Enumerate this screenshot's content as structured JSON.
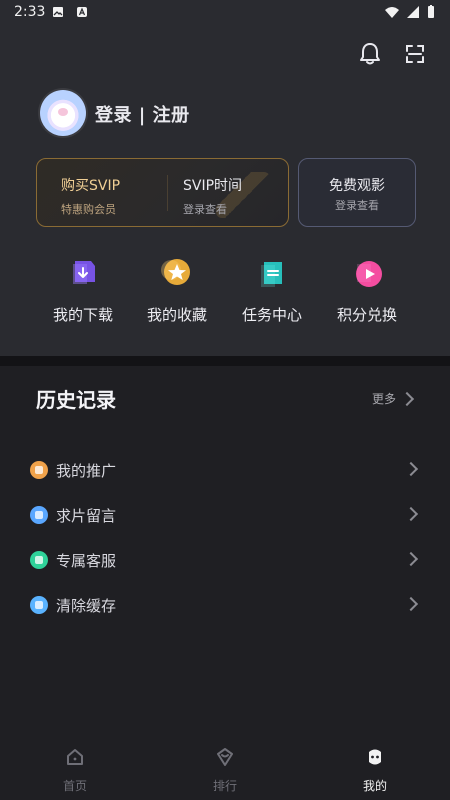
{
  "status_bar": {
    "time": "2:33"
  },
  "header": {
    "login_text": "登录 | 注册"
  },
  "vip_card": {
    "left": {
      "title": "购买SVIP",
      "subtitle": "特惠购会员"
    },
    "right": {
      "title": "SVIP时间",
      "subtitle": "登录查看"
    }
  },
  "free_card": {
    "title": "免费观影",
    "subtitle": "登录查看"
  },
  "grid": [
    {
      "label": "我的下载",
      "icon": "download-icon",
      "color": "#8a5cff"
    },
    {
      "label": "我的收藏",
      "icon": "star-icon",
      "color": "#f0b13a"
    },
    {
      "label": "任务中心",
      "icon": "task-icon",
      "color": "#27c7c3"
    },
    {
      "label": "积分兑换",
      "icon": "play-icon",
      "color": "#ff4fa6"
    }
  ],
  "history": {
    "title": "历史记录",
    "more_label": "更多"
  },
  "list": [
    {
      "label": "我的推广",
      "icon": "promotion-icon",
      "color": "#f0a24a"
    },
    {
      "label": "求片留言",
      "icon": "message-icon",
      "color": "#5aa7ff"
    },
    {
      "label": "专属客服",
      "icon": "support-icon",
      "color": "#2fd39a"
    },
    {
      "label": "清除缓存",
      "icon": "cloud-icon",
      "color": "#5ab3ff"
    }
  ],
  "tabbar": [
    {
      "label": "首页",
      "icon": "home-icon",
      "active": false
    },
    {
      "label": "排行",
      "icon": "ranking-icon",
      "active": false
    },
    {
      "label": "我的",
      "icon": "profile-icon",
      "active": true
    }
  ],
  "colors": {
    "background": "#1f1f23",
    "panel": "#2a2b30",
    "vip_border": "#8a6b34",
    "free_border": "#555a73",
    "text_primary": "#ededf2",
    "text_secondary": "#a8a8ae"
  }
}
